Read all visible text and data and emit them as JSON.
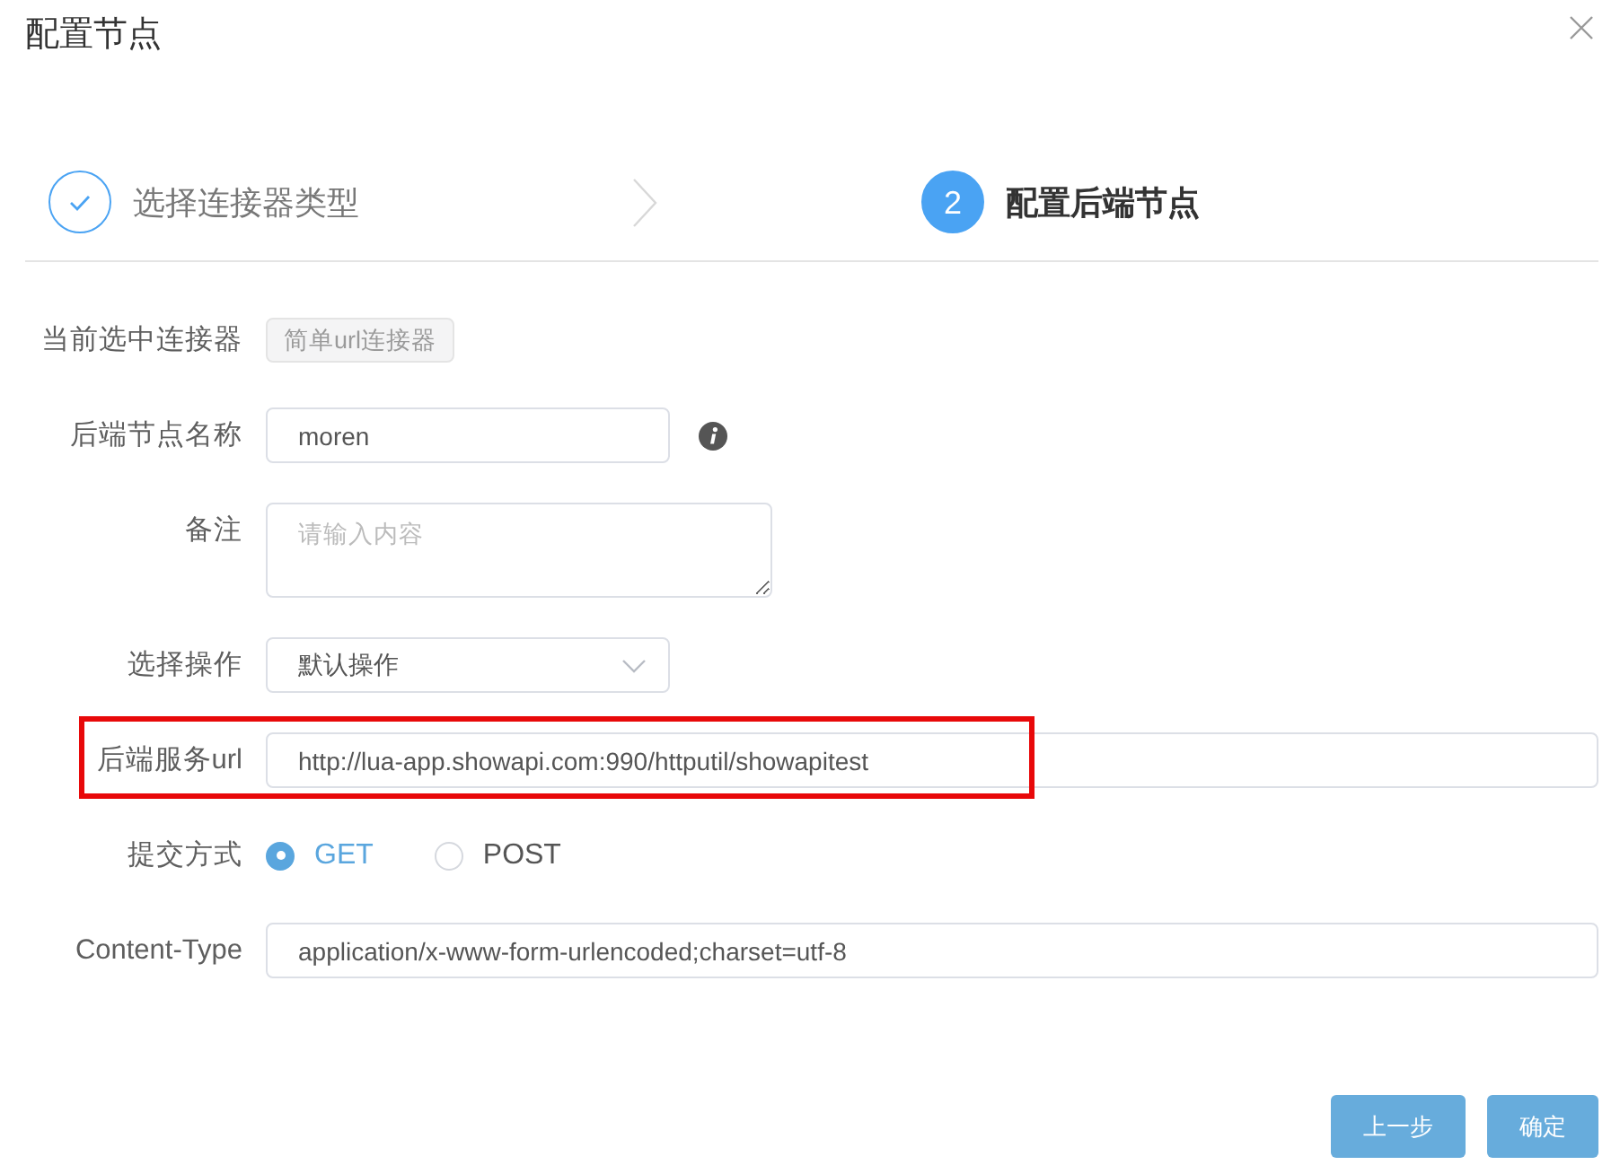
{
  "dialog": {
    "title": "配置节点"
  },
  "steps": [
    {
      "label": "选择连接器类型",
      "done": true,
      "active": false
    },
    {
      "label": "配置后端节点",
      "number": "2",
      "done": false,
      "active": true
    }
  ],
  "form": {
    "rows": [
      {
        "kind": "tag",
        "label": "当前选中连接器",
        "value": "简单url连接器"
      },
      {
        "kind": "input",
        "label": "后端节点名称",
        "value": "moren",
        "info": true
      },
      {
        "kind": "textarea",
        "label": "备注",
        "placeholder": "请输入内容"
      },
      {
        "kind": "select",
        "label": "选择操作",
        "value": "默认操作"
      },
      {
        "kind": "input",
        "label": "后端服务url",
        "value": "http://lua-app.showapi.com:990/httputil/showapitest",
        "highlighted": true
      },
      {
        "kind": "radio",
        "label": "提交方式",
        "options": [
          {
            "label": "GET",
            "selected": true
          },
          {
            "label": "POST",
            "selected": false
          }
        ]
      },
      {
        "kind": "input",
        "label": "Content-Type",
        "value": "application/x-www-form-urlencoded;charset=utf-8"
      }
    ]
  },
  "buttons": [
    "上一步",
    "确定"
  ]
}
